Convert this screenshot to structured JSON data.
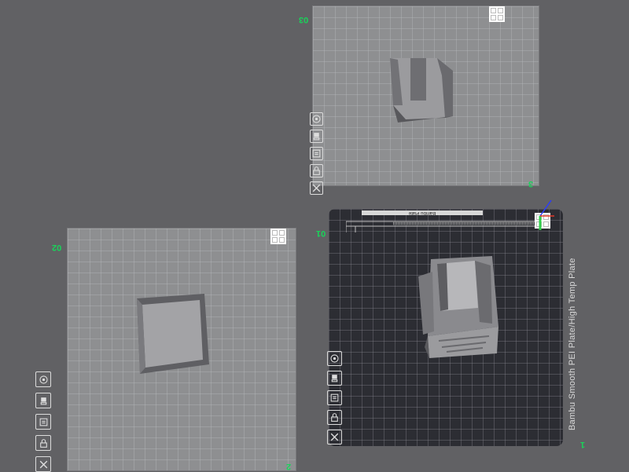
{
  "plates": [
    {
      "id": "plate-03",
      "number": "03",
      "corner": "3",
      "active": false
    },
    {
      "id": "plate-02",
      "number": "02",
      "corner": "2",
      "active": false
    },
    {
      "id": "plate-01",
      "number": "01",
      "corner": "1",
      "active": true,
      "bed_label": "Bambu Smooth PEI Plate/High Temp Plate",
      "top_strip": "Bambu Plate"
    }
  ],
  "plate_icons": [
    "orient-icon",
    "auto-arrange-icon",
    "plate-settings-icon",
    "lock-icon",
    "delete-plate-icon"
  ],
  "colors": {
    "background": "#616164",
    "plate": "#8e8f91",
    "active_plate": "#2c2d33",
    "plate_number": "#19d35a"
  }
}
